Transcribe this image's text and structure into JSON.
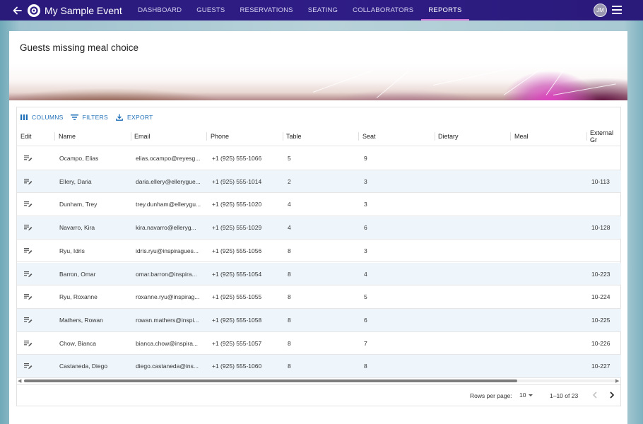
{
  "app": {
    "title": "My Sample Event",
    "avatar_initials": "JM",
    "nav_tabs": [
      "DASHBOARD",
      "GUESTS",
      "RESERVATIONS",
      "SEATING",
      "COLLABORATORS",
      "REPORTS"
    ],
    "active_tab": "REPORTS",
    "icons": {
      "back": "arrow-left-icon",
      "logo": "event-logo-icon",
      "menu": "hamburger-menu-icon"
    }
  },
  "report": {
    "title": "Guests missing meal choice",
    "toolbar": {
      "columns": "COLUMNS",
      "filters": "FILTERS",
      "export": "EXPORT"
    },
    "columns": [
      "Edit",
      "Name",
      "Email",
      "Phone",
      "Table",
      "Seat",
      "Dietary",
      "Meal",
      "External Gr"
    ],
    "rows": [
      {
        "name": "Ocampo, Elias",
        "email": "elias.ocampo@reyesg...",
        "phone": "+1 (925) 555-1066",
        "table": "5",
        "seat": "9",
        "dietary": "",
        "meal": "",
        "external": ""
      },
      {
        "name": "Ellery, Daria",
        "email": "daria.ellery@ellerygue...",
        "phone": "+1 (925) 555-1014",
        "table": "2",
        "seat": "3",
        "dietary": "",
        "meal": "",
        "external": "10-113"
      },
      {
        "name": "Dunham, Trey",
        "email": "trey.dunham@ellerygu...",
        "phone": "+1 (925) 555-1020",
        "table": "4",
        "seat": "3",
        "dietary": "",
        "meal": "",
        "external": ""
      },
      {
        "name": "Navarro, Kira",
        "email": "kira.navarro@elleryg...",
        "phone": "+1 (925) 555-1029",
        "table": "4",
        "seat": "6",
        "dietary": "",
        "meal": "",
        "external": "10-128"
      },
      {
        "name": "Ryu, Idris",
        "email": "idris.ryu@inspiragues...",
        "phone": "+1 (925) 555-1056",
        "table": "8",
        "seat": "3",
        "dietary": "",
        "meal": "",
        "external": ""
      },
      {
        "name": "Barron, Omar",
        "email": "omar.barron@inspira...",
        "phone": "+1 (925) 555-1054",
        "table": "8",
        "seat": "4",
        "dietary": "",
        "meal": "",
        "external": "10-223"
      },
      {
        "name": "Ryu, Roxanne",
        "email": "roxanne.ryu@inspirag...",
        "phone": "+1 (925) 555-1055",
        "table": "8",
        "seat": "5",
        "dietary": "",
        "meal": "",
        "external": "10-224"
      },
      {
        "name": "Mathers, Rowan",
        "email": "rowan.mathers@inspi...",
        "phone": "+1 (925) 555-1058",
        "table": "8",
        "seat": "6",
        "dietary": "",
        "meal": "",
        "external": "10-225"
      },
      {
        "name": "Chow, Bianca",
        "email": "bianca.chow@inspira...",
        "phone": "+1 (925) 555-1057",
        "table": "8",
        "seat": "7",
        "dietary": "",
        "meal": "",
        "external": "10-226"
      },
      {
        "name": "Castaneda, Diego",
        "email": "diego.castaneda@ins...",
        "phone": "+1 (925) 555-1060",
        "table": "8",
        "seat": "8",
        "dietary": "",
        "meal": "",
        "external": "10-227"
      }
    ],
    "pagination": {
      "rows_per_page_label": "Rows per page:",
      "rows_per_page": "10",
      "range": "1–10 of 23"
    }
  },
  "colors": {
    "topbar": "#2f1d86",
    "accent_link": "#1f6fb8",
    "active_tab_indicator": "#d27ad9",
    "row_alt": "#eef6fc"
  }
}
